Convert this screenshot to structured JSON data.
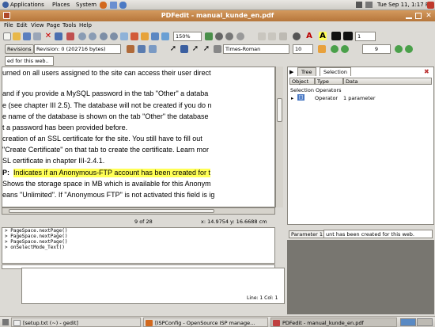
{
  "system": {
    "menus": [
      "Applications",
      "Places",
      "System"
    ],
    "clock": "Tue Sep 11,  1:17 PM"
  },
  "window": {
    "title": "PDFedit - manual_kunde_en.pdf"
  },
  "menubar": [
    "File",
    "Edit",
    "View",
    "Page",
    "Tools",
    "Help"
  ],
  "toolbar": {
    "zoom": "150%",
    "line_width": "1",
    "revisions_label": "Revisions",
    "revision_select": "Revision: 0 (202716 bytes)",
    "font_select": "Times-Roman",
    "font_size": "10",
    "page_number": "9",
    "search_value": "ed for this web.."
  },
  "document": {
    "lines": [
      "urned on all users assigned to the site can access their user direct",
      "and if you provide a MySQL password in the tab \"Other\" a databa",
      "e (see chapter III 2.5). The database will not be created if you do n",
      "e name of the database is shown on the tab \"Other\" the database",
      "t a password has been provided before.",
      "creation of an SSL certificate for the site. You still have to fill out",
      "\"Create Certificate\" on that tab to create the certificate. Learn mor",
      "SL certificate in chapter III-2.4.1.",
      "P:",
      "Indicates if an Anonymous-FTP account has been created for t",
      "Shows the storage space in MB which is available for this Anonym",
      "eans \"Unlimited\". If \"Anonymous FTP\" is not activated this field is ig"
    ]
  },
  "status": {
    "page": "9 of 28",
    "coords": "x: 14.9754 y: 16.6688 cm"
  },
  "console": {
    "lines": [
      "> PageSpace.nextPage()",
      "> PageSpace.nextPage()",
      "> PageSpace.nextPage()",
      "> onSelectMode_Text()"
    ]
  },
  "editor_status": "Line: 1 Col: 1",
  "panel": {
    "tabs": [
      "Tree",
      "Selection"
    ],
    "columns": [
      "Object",
      "Type",
      "Data"
    ],
    "group": "Selection Operators",
    "row": {
      "object": "[]",
      "type": "Operator",
      "data": "1 parameter"
    },
    "param_label": "Parameter 1:",
    "param_value": "unt has been created for this web."
  },
  "taskbar": [
    "[setup.txt (~) - gedit]",
    "[ISPConfig - OpenSource ISP manage...",
    "PDFedit - manual_kunde_en.pdf"
  ],
  "colors": {
    "titlebar": "#c78748",
    "highlight": "#ffff55"
  }
}
